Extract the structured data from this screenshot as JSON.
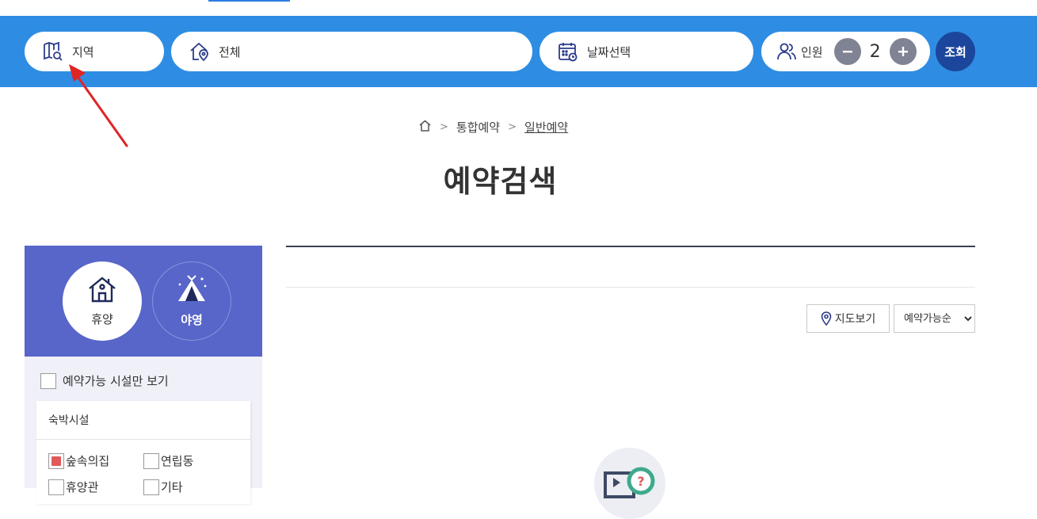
{
  "search": {
    "region_label": "지역",
    "category_label": "전체",
    "date_label": "날짜선택",
    "people_label": "인원",
    "people_count": "2",
    "search_button": "조회"
  },
  "breadcrumb": {
    "level1": "통합예약",
    "level2": "일반예약"
  },
  "page_title": "예약검색",
  "sidebar": {
    "types": [
      {
        "label": "휴양",
        "icon": "house-icon",
        "selected": true
      },
      {
        "label": "야영",
        "icon": "tent-icon",
        "selected": false
      }
    ],
    "available_only_label": "예약가능 시설만 보기",
    "facility_section_title": "숙박시설",
    "facilities": [
      {
        "label": "숲속의집",
        "checked": true
      },
      {
        "label": "연립동",
        "checked": false
      },
      {
        "label": "휴양관",
        "checked": false
      },
      {
        "label": "기타",
        "checked": false
      }
    ]
  },
  "results": {
    "map_view_label": "지도보기",
    "sort_options": [
      "예약가능순"
    ],
    "sort_selected": "예약가능순"
  },
  "colors": {
    "search_bar": "#2e8de3",
    "search_button": "#1b469c",
    "sidebar_header": "#5865c9",
    "sidebar_bg": "#eff0f8",
    "arrow": "#e02525"
  }
}
